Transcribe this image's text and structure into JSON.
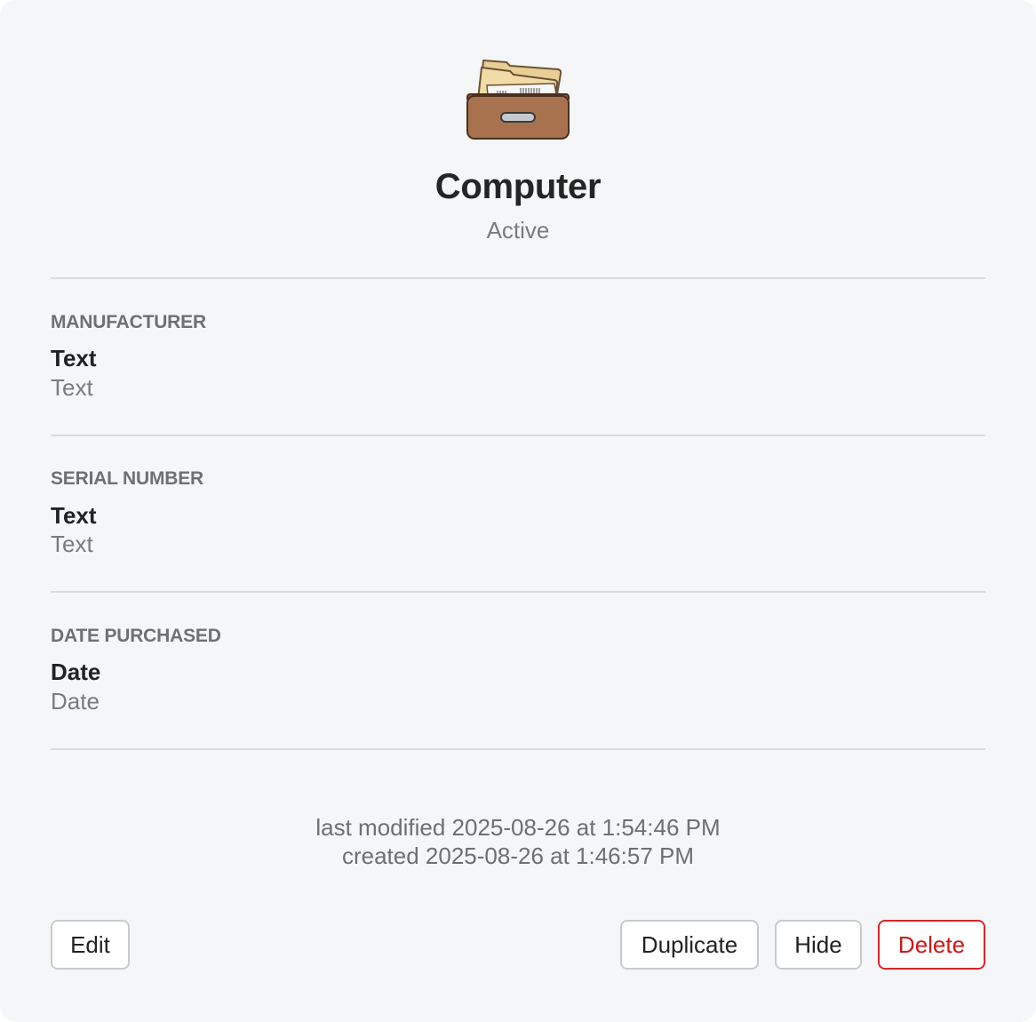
{
  "item": {
    "icon": "file-cabinet-drawer-icon",
    "title": "Computer",
    "status": "Active"
  },
  "fields": [
    {
      "label": "MANUFACTURER",
      "value": "Text",
      "type": "Text"
    },
    {
      "label": "SERIAL NUMBER",
      "value": "Text",
      "type": "Text"
    },
    {
      "label": "DATE PURCHASED",
      "value": "Date",
      "type": "Date"
    }
  ],
  "meta": {
    "last_modified": "last modified 2025-08-26 at 1:54:46 PM",
    "created": "created 2025-08-26 at 1:46:57 PM"
  },
  "buttons": {
    "edit": "Edit",
    "duplicate": "Duplicate",
    "hide": "Hide",
    "delete": "Delete"
  },
  "colors": {
    "background": "#f5f6f8",
    "delete_accent": "#d01616",
    "drawer_brown": "#a8724f"
  }
}
